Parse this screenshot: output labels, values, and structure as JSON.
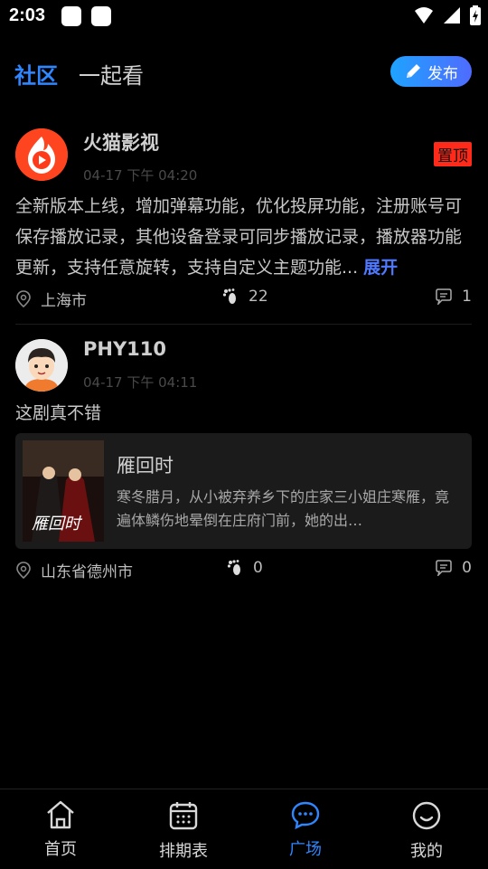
{
  "status": {
    "time": "2:03"
  },
  "header": {
    "tabs": [
      {
        "label": "社区"
      },
      {
        "label": "一起看"
      }
    ],
    "publish_label": "发布"
  },
  "posts": [
    {
      "author": "火猫影视",
      "time": "04-17 下午 04:20",
      "pin": "置顶",
      "text": "全新版本上线，增加弹幕功能，优化投屏功能，注册账号可保存播放记录，其他设备登录可同步播放记录，播放器功能更新，支持任意旋转，支持自定义主题功能...",
      "expand": "展开",
      "location": "上海市",
      "steps": "22",
      "comments": "1"
    },
    {
      "author": "PHY110",
      "time": "04-17 下午 04:11",
      "text": "这剧真不错",
      "card": {
        "title": "雁回时",
        "poster_text": "雁回时",
        "desc": "寒冬腊月，从小被弃养乡下的庄家三小姐庄寒雁，竟遍体鳞伤地晕倒在庄府门前，她的出…"
      },
      "location": "山东省德州市",
      "steps": "0",
      "comments": "0"
    }
  ],
  "nav": [
    {
      "label": "首页"
    },
    {
      "label": "排期表"
    },
    {
      "label": "广场"
    },
    {
      "label": "我的"
    }
  ],
  "colors": {
    "accent": "#2f86ff",
    "pin": "#ff2a1a",
    "expand": "#4f79ff"
  }
}
